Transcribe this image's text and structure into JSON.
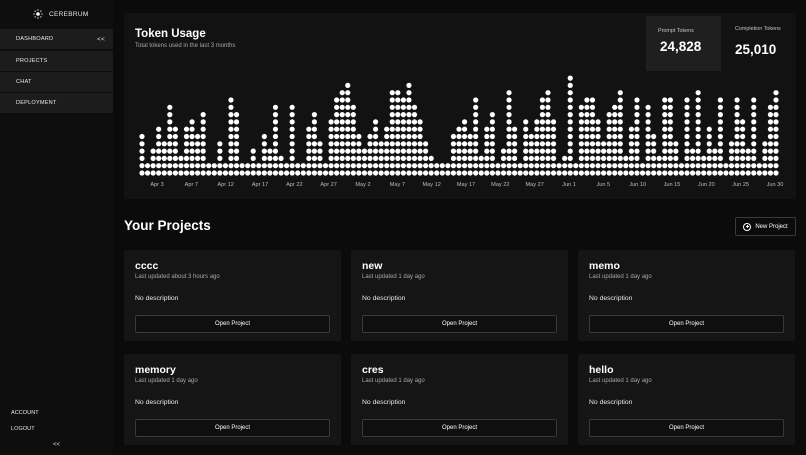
{
  "app": {
    "brand": "CEREBRUM",
    "brand_icon": "sun-icon"
  },
  "sidebar": {
    "items": [
      {
        "label": "DASHBOARD",
        "active": true
      },
      {
        "label": "PROJECTS",
        "active": false
      },
      {
        "label": "CHAT",
        "active": false
      },
      {
        "label": "DEPLOYMENT",
        "active": false
      }
    ],
    "collapse_label": "<<",
    "account_label": "ACCOUNT",
    "logout_label": "LOGOUT",
    "bottom_collapse_label": "<<"
  },
  "token_usage": {
    "title": "Token Usage",
    "subtitle": "Total tokens used in the last 3 months",
    "prompt_label": "Prompt Tokens",
    "prompt_value": "24,828",
    "completion_label": "Completion Tokens",
    "completion_value": "25,010"
  },
  "chart_data": {
    "type": "bar",
    "style": "dot-matrix",
    "x_tick_labels": [
      "Apr 3",
      "Apr 7",
      "Apr 12",
      "Apr 17",
      "Apr 22",
      "Apr 27",
      "May 2",
      "May 7",
      "May 12",
      "May 17",
      "May 22",
      "May 27",
      "Jun 1",
      "Jun 5",
      "Jun 10",
      "Jun 15",
      "Jun 20",
      "Jun 25",
      "Jun 30"
    ],
    "values": [
      6,
      2,
      4,
      7,
      5,
      10,
      7,
      3,
      7,
      8,
      6,
      9,
      2,
      2,
      5,
      2,
      11,
      9,
      2,
      2,
      4,
      2,
      6,
      4,
      10,
      3,
      2,
      10,
      2,
      2,
      7,
      9,
      5,
      2,
      8,
      11,
      12,
      13,
      10,
      6,
      4,
      6,
      8,
      5,
      7,
      12,
      12,
      11,
      13,
      10,
      8,
      5,
      3,
      2,
      2,
      2,
      6,
      7,
      8,
      6,
      11,
      3,
      7,
      9,
      2,
      4,
      12,
      7,
      2,
      8,
      6,
      8,
      11,
      12,
      8,
      2,
      3,
      14,
      2,
      10,
      11,
      11,
      8,
      5,
      9,
      10,
      12,
      3,
      7,
      11,
      2,
      10,
      6,
      3,
      11,
      11,
      5,
      2,
      11,
      4,
      12,
      3,
      7,
      4,
      11,
      2,
      5,
      11,
      8,
      4,
      11,
      2,
      5,
      10,
      12
    ],
    "unit_dots": true,
    "grid": false,
    "legend": "none",
    "dot_color": "#ffffff"
  },
  "projects": {
    "title": "Your Projects",
    "new_button_label": "New Project",
    "new_button_icon": "plus-circle-icon",
    "items": [
      {
        "name": "cccc",
        "updated": "Last updated about 3 hours ago",
        "description": "No description",
        "button": "Open Project"
      },
      {
        "name": "new",
        "updated": "Last updated 1 day ago",
        "description": "No description",
        "button": "Open Project"
      },
      {
        "name": "memo",
        "updated": "Last updated 1 day ago",
        "description": "No description",
        "button": "Open Project"
      },
      {
        "name": "memory",
        "updated": "Last updated 1 day ago",
        "description": "No description",
        "button": "Open Project"
      },
      {
        "name": "cres",
        "updated": "Last updated 1 day ago",
        "description": "No description",
        "button": "Open Project"
      },
      {
        "name": "hello",
        "updated": "Last updated 1 day ago",
        "description": "No description",
        "button": "Open Project"
      }
    ]
  }
}
